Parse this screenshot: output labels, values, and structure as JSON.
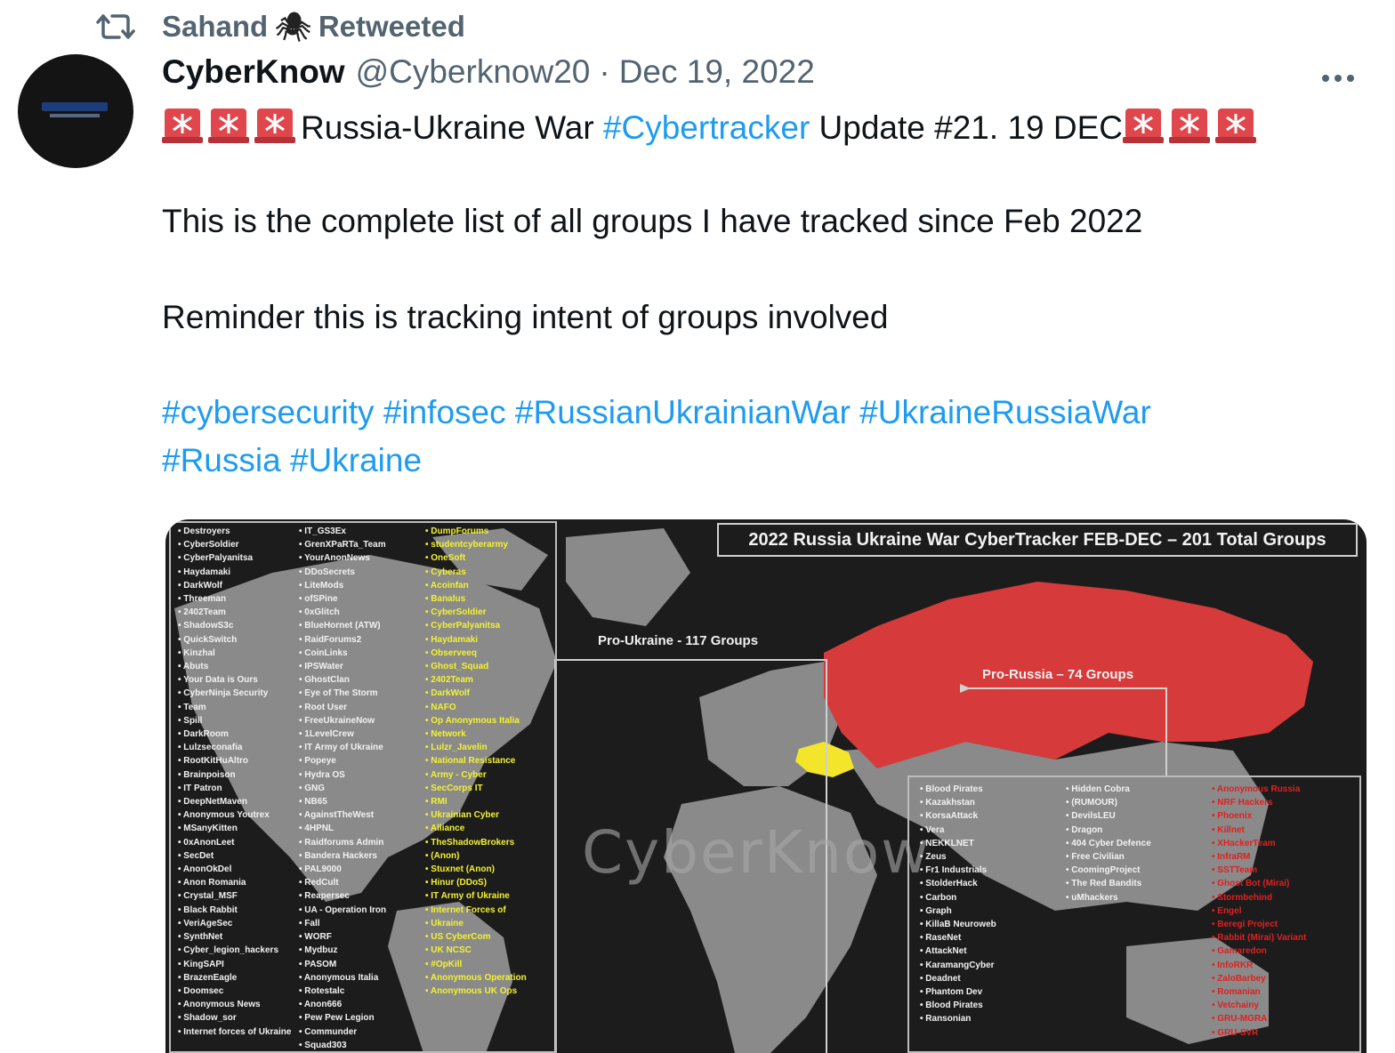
{
  "retweet": {
    "user": "Sahand",
    "emoji": "🕷",
    "label": "Retweeted"
  },
  "author": {
    "name": "CyberKnow",
    "handle": "@Cyberknow20",
    "separator": "·",
    "date": "Dec 19, 2022"
  },
  "tweet": {
    "line1_text": "Russia-Ukraine War ",
    "line1_tag": "#Cybertracker",
    "line1_rest": " Update #21. 19 DEC",
    "line2": "This is the complete list of all groups I have tracked since Feb 2022",
    "line3": "Reminder this is tracking intent of groups involved",
    "hashtags_row1": "#cybersecurity #infosec #RussianUkrainianWar #UkraineRussiaWar",
    "hashtags_row2": "#Russia #Ukraine"
  },
  "media": {
    "title": "2022 Russia Ukraine War CyberTracker FEB-DEC – 201 Total Groups",
    "pro_ukraine_label": "Pro-Ukraine - 117 Groups",
    "pro_russia_label": "Pro-Russia – 74 Groups",
    "watermark": "CyberKnow",
    "colors": {
      "background": "#1c1c1c",
      "land": "#8a8a8a",
      "russia": "#d63a3a",
      "ukraine": "#f3e62a"
    },
    "pro_ukraine_col1": [
      "Destroyers",
      "CyberSoldier",
      "CyberPalyanitsa",
      "Haydamaki",
      "DarkWolf",
      "Threeman",
      "2402Team",
      "ShadowS3c",
      "QuickSwitch",
      "Kinzhal",
      "Abuts",
      "Your Data is Ours",
      "CyberNinja Security",
      "Team",
      "Spill",
      "DarkRoom",
      "Lulzseconafia",
      "RootKitHuAltro",
      "Brainpoison",
      "IT Patron",
      "DeepNetMaven",
      "Anonymous Youtrex",
      "MSanyKitten",
      "0xAnonLeet",
      "SecDet",
      "AnonOkDel",
      "Anon Romania",
      "Crystal_MSF",
      "Black Rabbit",
      "VeriAgeSec",
      "SynthNet",
      "Cyber_legion_hackers",
      "KingSAPI",
      "BrazenEagle",
      "Doomsec",
      "Anonymous News",
      "Shadow_sor",
      "Internet forces of Ukraine"
    ],
    "pro_ukraine_col2": [
      "IT_GS3Ex",
      "GrenXPaRTa_Team",
      "YourAnonNews",
      "DDoSecrets",
      "LiteMods",
      "ofSPine",
      "0xGlitch",
      "BlueHornet (ATW)",
      "RaidForums2",
      "CoinLinks",
      "IPSWater",
      "GhostClan",
      "Eye of The Storm",
      "Root User",
      "FreeUkraineNow",
      "1LevelCrew",
      "IT Army of Ukraine",
      "Popeye",
      "Hydra OS",
      "GNG",
      "NB65",
      "AgainstTheWest",
      "4HPNL",
      "Raidforums Admin",
      "Bandera Hackers",
      "PAL9000",
      "RedCult",
      "Reapersec",
      "UA - Operation Iron",
      "Fall",
      "WORF",
      "Mydbuz",
      "PASOM",
      "Anonymous Italia",
      "Rotestalc",
      "Anon666",
      "Pew Pew Legion",
      "Communder",
      "Squad303"
    ],
    "pro_ukraine_col3": [
      "DumpForums",
      "studentcyberarmy",
      "OneSoft",
      "Cyberas",
      "Acoinfan",
      "Banalus",
      "CyberSoldier",
      "CyberPalyanitsa",
      "Haydamaki",
      "Observeeq",
      "Ghost_Squad",
      "2402Team",
      "DarkWolf",
      "NAFO",
      "Op Anonymous Italia",
      "Network",
      "Lulzr_Javelin",
      "National Resistance",
      "Army - Cyber",
      "SecCorps IT",
      "RMI",
      "Ukrainian Cyber",
      "Alliance",
      "TheShadowBrokers",
      "(Anon)",
      "Stuxnet (Anon)",
      "Hinur (DDoS)",
      "IT Army of Ukraine",
      "Internet Forces of",
      "Ukraine",
      "US CyberCom",
      "UK NCSC",
      "#OpKill",
      "Anonymous Operation",
      "Anonymous UK Ops"
    ],
    "pro_russia_col1": [
      "Blood Pirates",
      "Kazakhstan",
      "KorsaAttack",
      "Vera",
      "NEKKLNET",
      "Zeus",
      "Fr1 Industrials",
      "StolderHack",
      "Carbon",
      "Graph",
      "KillaB Neuroweb",
      "RaseNet",
      "AttackNet",
      "KaramangCyber",
      "Deadnet",
      "Phantom Dev",
      "Blood Pirates",
      "Ransonian"
    ],
    "pro_russia_col2": [
      "Hidden Cobra",
      "(RUMOUR)",
      "DevilsLEU",
      "Dragon",
      "404 Cyber Defence",
      "Free Civilian",
      "CoomingProject",
      "The Red Bandits",
      "uMhackers"
    ],
    "pro_russia_col3": [
      "Anonymous Russia",
      "NRF Hackers",
      "Phoenix",
      "Killnet",
      "XHackerTeam",
      "InfraRM",
      "SSTTeam",
      "Ghost Bot (Mirai)",
      "Stormbehind",
      "Engel",
      "Beregi Project",
      "Rabbit (Mirai) Variant",
      "Gamaredon",
      "InfoRKR",
      "ZaloBarbey",
      "Romanian",
      "Vetchainy",
      "GRU-MGRA",
      "GRU-SVR"
    ]
  }
}
